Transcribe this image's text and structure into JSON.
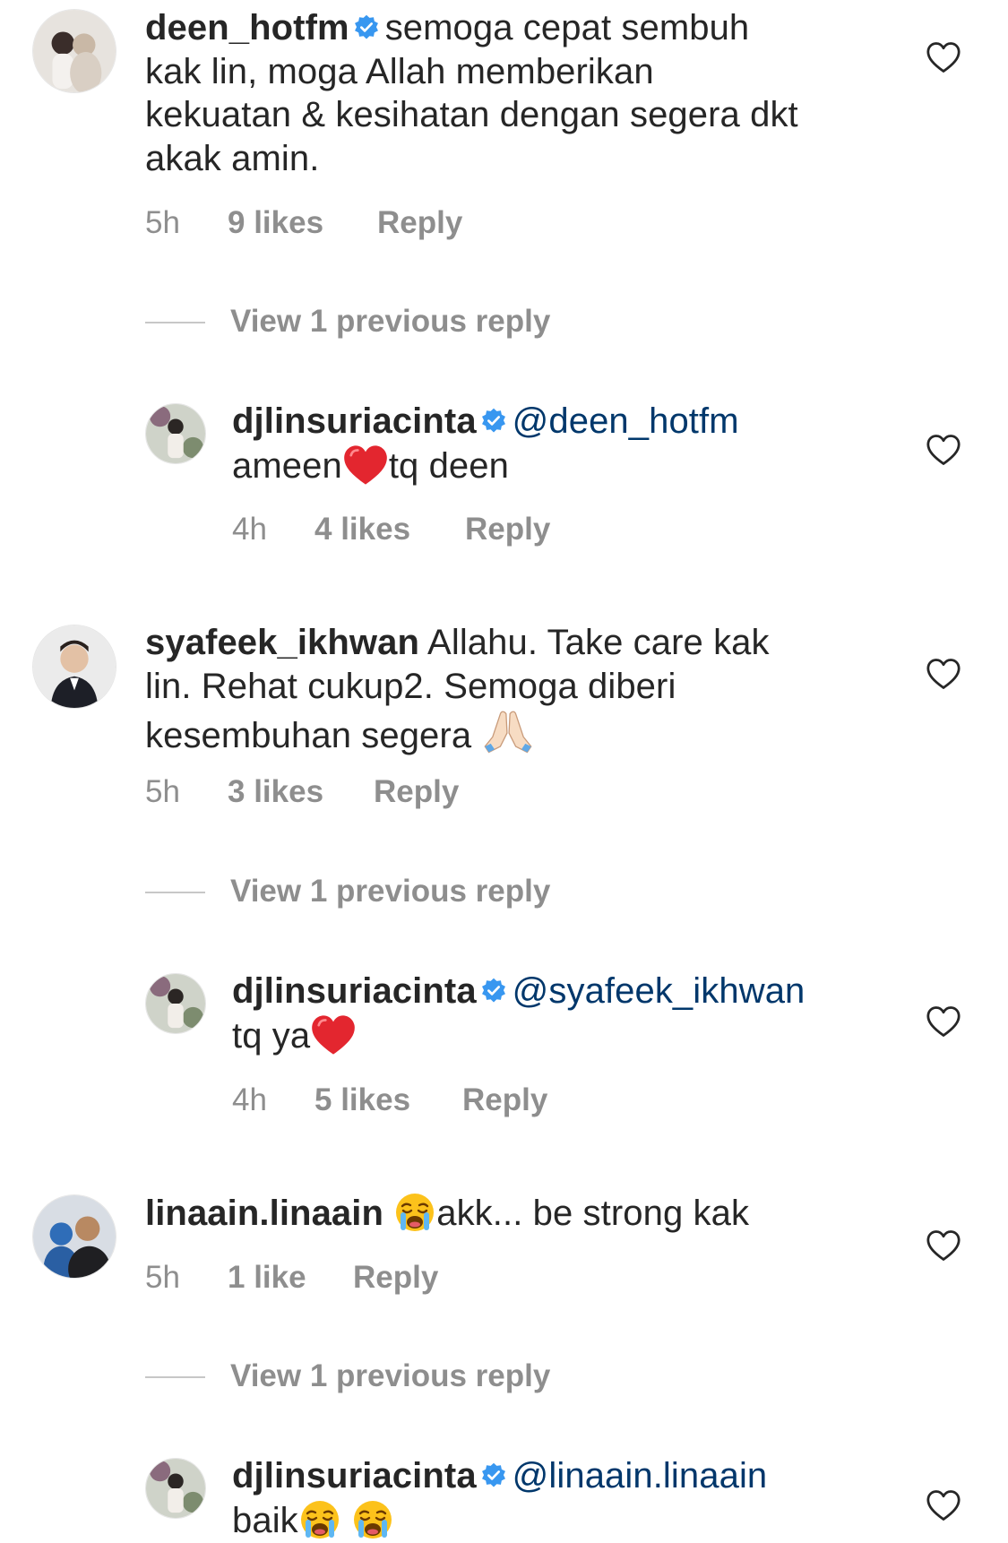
{
  "comments": [
    {
      "username": "deen_hotfm",
      "verified": true,
      "text": "semoga cepat sembuh kak lin, moga  Allah memberikan kekuatan & kesihatan dengan segera dkt akak amin.",
      "lines": [
        "semoga cepat sembuh",
        "kak lin, moga  Allah memberikan",
        "kekuatan & kesihatan dengan segera dkt",
        "akak amin."
      ],
      "time": "5h",
      "likes": "9 likes",
      "reply_label": "Reply",
      "view_replies": "View 1 previous reply",
      "reply": {
        "username": "djlinsuriacinta",
        "verified": true,
        "mention": "@deen_hotfm",
        "text_before": "ameen",
        "text_after": "tq deen",
        "time": "4h",
        "likes": "4 likes",
        "reply_label": "Reply"
      }
    },
    {
      "username": "syafeek_ikhwan",
      "verified": false,
      "lines": [
        "Allahu. Take care kak",
        "lin. Rehat cukup2. Semoga diberi",
        "kesembuhan segera"
      ],
      "time": "5h",
      "likes": "3 likes",
      "reply_label": "Reply",
      "view_replies": "View 1 previous reply",
      "reply": {
        "username": "djlinsuriacinta",
        "verified": true,
        "mention": "@syafeek_ikhwan",
        "text_before": "tq ya",
        "time": "4h",
        "likes": "5 likes",
        "reply_label": "Reply"
      }
    },
    {
      "username": "linaain.linaain",
      "verified": false,
      "text_after": "akk... be strong kak",
      "time": "5h",
      "likes": "1 like",
      "reply_label": "Reply",
      "view_replies": "View 1 previous reply",
      "reply": {
        "username": "djlinsuriacinta",
        "verified": true,
        "mention": "@linaain.linaain",
        "text_before": "baik"
      }
    }
  ],
  "icons": {
    "verified": "verified-badge-icon",
    "like": "heart-outline-icon",
    "emoji_heart": "red-heart-emoji",
    "emoji_pray": "folded-hands-emoji",
    "emoji_cry": "loudly-crying-face-emoji"
  },
  "colors": {
    "text": "#262626",
    "secondary": "#8e8e8e",
    "mention": "#00376b",
    "verified": "#3897f0",
    "divider": "#c7c7c7"
  }
}
